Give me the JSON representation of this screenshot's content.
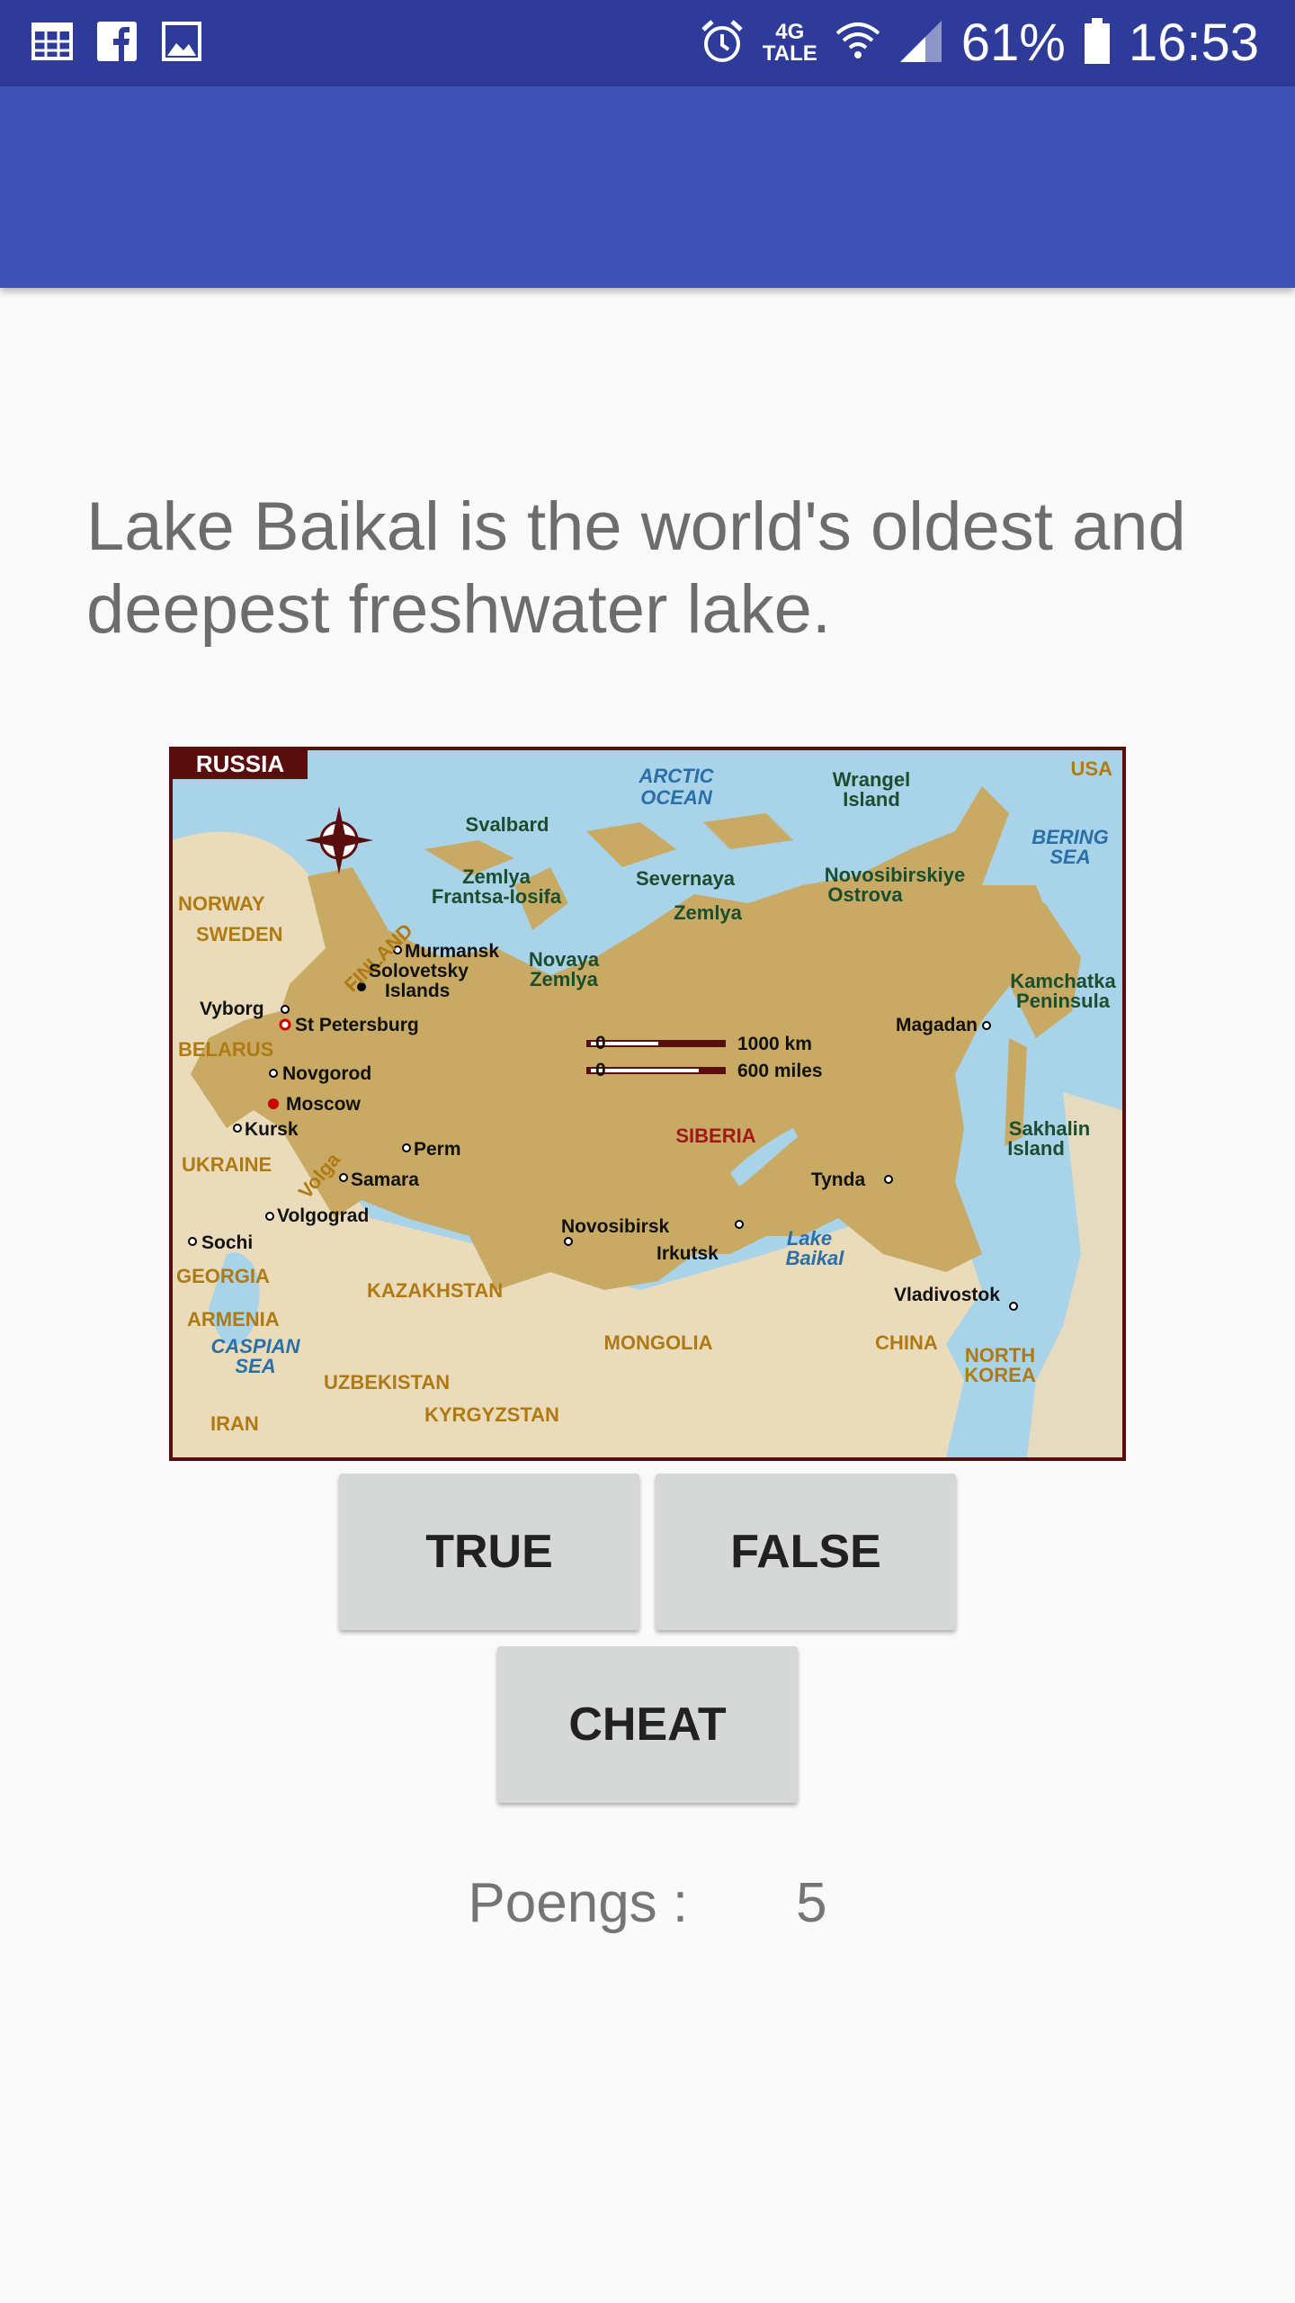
{
  "status_bar": {
    "left_icons": [
      "calendar-icon",
      "facebook-icon",
      "gallery-icon"
    ],
    "right_icons": [
      "alarm-icon",
      "wifi-icon",
      "signal-icon",
      "battery-icon"
    ],
    "network_top": "4G",
    "network_bottom": "TALE",
    "battery": "61%",
    "time": "16:53"
  },
  "app_bar": {
    "title": ""
  },
  "question": {
    "text": "Lake Baikal is the world's oldest and deepest freshwater lake."
  },
  "map": {
    "title": "RUSSIA",
    "labels": {
      "arctic1": "ARCTIC",
      "arctic2": "OCEAN",
      "wrangel1": "Wrangel",
      "wrangel2": "Island",
      "usa": "USA",
      "bering1": "BERING",
      "bering2": "SEA",
      "svalbard": "Svalbard",
      "zemlya_fi1": "Zemlya",
      "zemlya_fi2": "Frantsa-Iosifa",
      "severnaya1": "Severnaya",
      "severnaya2": "Zemlya",
      "novosib1": "Novosibirskiye",
      "novosib2": "Ostrova",
      "norway": "NORWAY",
      "sweden": "SWEDEN",
      "finland": "FINLAND",
      "murmansk": "Murmansk",
      "solovetsky1": "Solovetsky",
      "solovetsky2": "Islands",
      "novaya1": "Novaya",
      "novaya2": "Zemlya",
      "kamchatka1": "Kamchatka",
      "kamchatka2": "Peninsula",
      "vyborg": "Vyborg",
      "stpetersburg": "St Petersburg",
      "magadan": "Magadan",
      "belarus": "BELARUS",
      "novgorod": "Novgorod",
      "moscow": "Moscow",
      "kursk": "Kursk",
      "scale_km": "1000 km",
      "scale_mi": "600 miles",
      "scale_zero": "0",
      "siberia": "SIBERIA",
      "sakhalin1": "Sakhalin",
      "sakhalin2": "Island",
      "ukraine": "UKRAINE",
      "volga": "Volga",
      "perm": "Perm",
      "samara": "Samara",
      "tynda": "Tynda",
      "volgograd": "Volgograd",
      "novosibirsk": "Novosibirsk",
      "lakebaikal1": "Lake",
      "lakebaikal2": "Baikal",
      "sochi": "Sochi",
      "irkutsk": "Irkutsk",
      "georgia": "GEORGIA",
      "kazakhstan": "KAZAKHSTAN",
      "vladivostok": "Vladivostok",
      "armenia": "ARMENIA",
      "caspian1": "CASPIAN",
      "caspian2": "SEA",
      "mongolia": "MONGOLIA",
      "china": "CHINA",
      "northkorea1": "NORTH",
      "northkorea2": "KOREA",
      "uzbekistan": "UZBEKISTAN",
      "kyrgyzstan": "KYRGYZSTAN",
      "iran": "IRAN"
    }
  },
  "buttons": {
    "true_label": "TRUE",
    "false_label": "FALSE",
    "cheat_label": "CHEAT"
  },
  "score": {
    "label": "Poengs :",
    "value": "5"
  },
  "colors": {
    "status_bar": "#2f3b98",
    "app_bar": "#3f51b5",
    "background": "#fafafa",
    "button": "#d6d7d7",
    "russia_land": "#c8aa64",
    "other_land": "#eadcbb",
    "water": "#a9d3e8"
  }
}
